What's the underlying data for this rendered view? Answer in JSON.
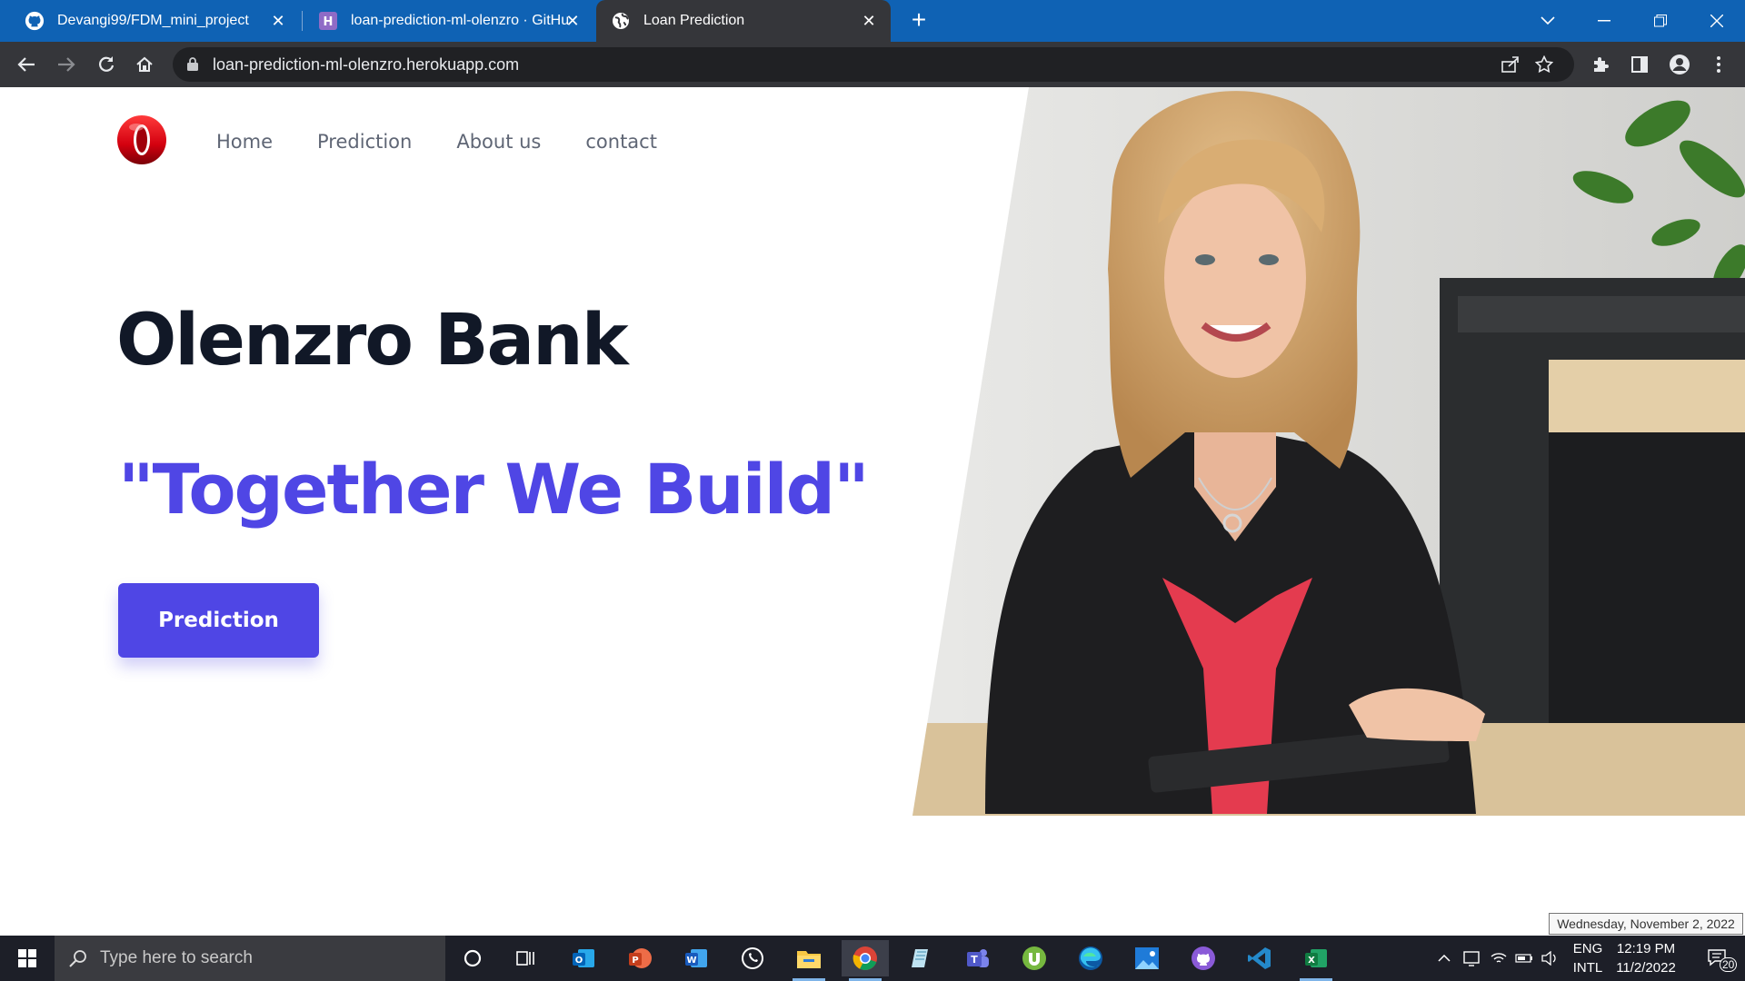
{
  "browser": {
    "tabs": [
      {
        "title": "Devangi99/FDM_mini_project",
        "active": false
      },
      {
        "title": "loan-prediction-ml-olenzro · GitHub",
        "active": false
      },
      {
        "title": "Loan Prediction",
        "active": true
      }
    ],
    "url": "loan-prediction-ml-olenzro.herokuapp.com"
  },
  "site": {
    "nav": [
      "Home",
      "Prediction",
      "About us",
      "contact"
    ],
    "brand_title": "Olenzro Bank",
    "slogan": "\"Together We Build\"",
    "cta_label": "Prediction"
  },
  "taskbar": {
    "search_placeholder": "Type here to search",
    "apps": [
      "cortana",
      "task-view",
      "outlook",
      "powerpoint",
      "word",
      "whatsapp",
      "file-explorer",
      "chrome",
      "notepad",
      "teams",
      "utorrent",
      "edge",
      "photos",
      "github-desktop",
      "vscode",
      "excel"
    ],
    "lang_line1": "ENG",
    "lang_line2": "INTL",
    "time": "12:19 PM",
    "date": "11/2/2022",
    "notification_count": "20",
    "date_tooltip": "Wednesday, November 2, 2022"
  },
  "colors": {
    "accent": "#4f46e5",
    "title": "#111827",
    "tabbar": "#0f62b4"
  }
}
